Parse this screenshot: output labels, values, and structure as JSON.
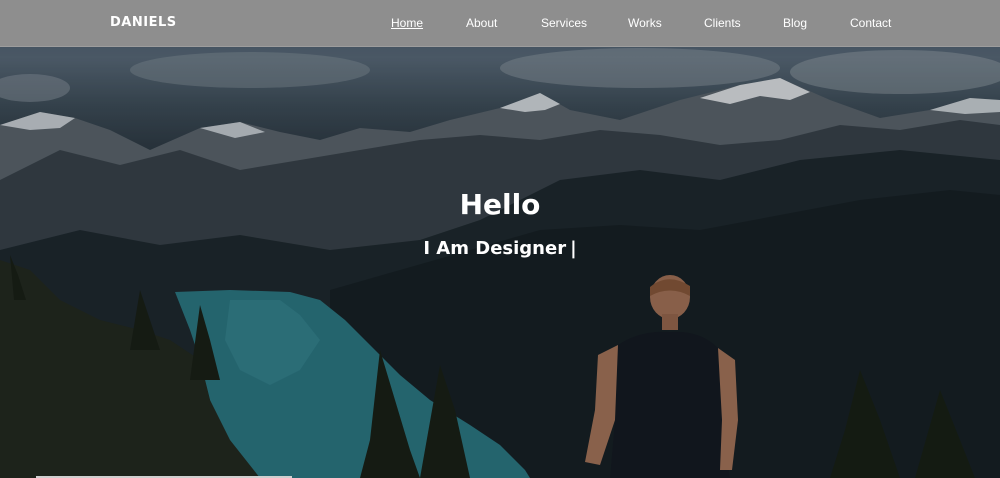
{
  "navbar": {
    "brand": "DANIELS",
    "items": [
      {
        "label": "Home",
        "active": true
      },
      {
        "label": "About",
        "active": false
      },
      {
        "label": "Services",
        "active": false
      },
      {
        "label": "Works",
        "active": false
      },
      {
        "label": "Clients",
        "active": false
      },
      {
        "label": "Blog",
        "active": false
      },
      {
        "label": "Contact",
        "active": false
      }
    ]
  },
  "hero": {
    "heading": "Hello",
    "tagline": "I Am Designer",
    "cursor": "|"
  },
  "colors": {
    "navbar_bg": "#8e8e8e",
    "text": "#ffffff",
    "lake": "#2f7f8a"
  }
}
